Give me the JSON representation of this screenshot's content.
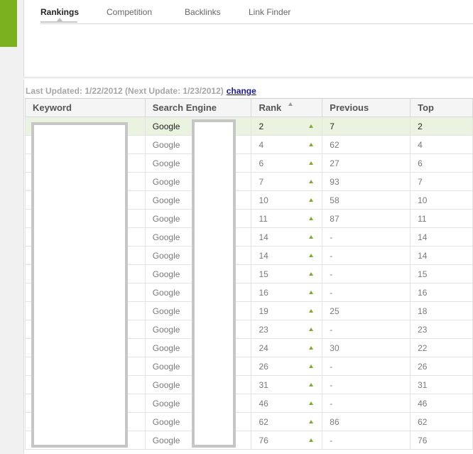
{
  "tabs": [
    {
      "label": "Rankings",
      "active": true
    },
    {
      "label": "Competition"
    },
    {
      "label": "Backlinks"
    },
    {
      "label": "Link Finder"
    }
  ],
  "status": {
    "text": "Last Updated: 1/22/2012 (Next Update: 1/23/2012)",
    "change_label": "change"
  },
  "table": {
    "headers": [
      "Keyword",
      "Search Engine",
      "Rank",
      "Previous",
      "Top"
    ],
    "rows": [
      {
        "engine": "Google",
        "rank": "2",
        "previous": "7",
        "top": "2"
      },
      {
        "engine": "Google",
        "rank": "4",
        "previous": "62",
        "top": "4"
      },
      {
        "engine": "Google",
        "rank": "6",
        "previous": "27",
        "top": "6"
      },
      {
        "engine": "Google",
        "rank": "7",
        "previous": "93",
        "top": "7"
      },
      {
        "engine": "Google",
        "rank": "10",
        "previous": "58",
        "top": "10"
      },
      {
        "engine": "Google",
        "rank": "11",
        "previous": "87",
        "top": "11"
      },
      {
        "engine": "Google",
        "rank": "14",
        "previous": "-",
        "top": "14"
      },
      {
        "engine": "Google",
        "rank": "14",
        "previous": "-",
        "top": "14"
      },
      {
        "engine": "Google",
        "rank": "15",
        "previous": "-",
        "top": "15"
      },
      {
        "engine": "Google",
        "rank": "16",
        "previous": "-",
        "top": "16"
      },
      {
        "engine": "Google",
        "rank": "19",
        "previous": "25",
        "top": "18"
      },
      {
        "engine": "Google",
        "rank": "23",
        "previous": "-",
        "top": "23"
      },
      {
        "engine": "Google",
        "rank": "24",
        "previous": "30",
        "top": "22"
      },
      {
        "engine": "Google",
        "rank": "26",
        "previous": "-",
        "top": "26"
      },
      {
        "engine": "Google",
        "rank": "31",
        "previous": "-",
        "top": "31"
      },
      {
        "engine": "Google",
        "rank": "46",
        "previous": "-",
        "top": "46"
      },
      {
        "engine": "Google",
        "rank": "62",
        "previous": "86",
        "top": "62"
      },
      {
        "engine": "Google",
        "rank": "76",
        "previous": "-",
        "top": "76"
      }
    ]
  },
  "icons": {
    "sort": "sort-asc-icon",
    "trend": "trend-up-icon"
  },
  "colors": {
    "accent": "#7bb01f",
    "highlight_row": "#e9f3df",
    "link": "#1a1a9a"
  }
}
